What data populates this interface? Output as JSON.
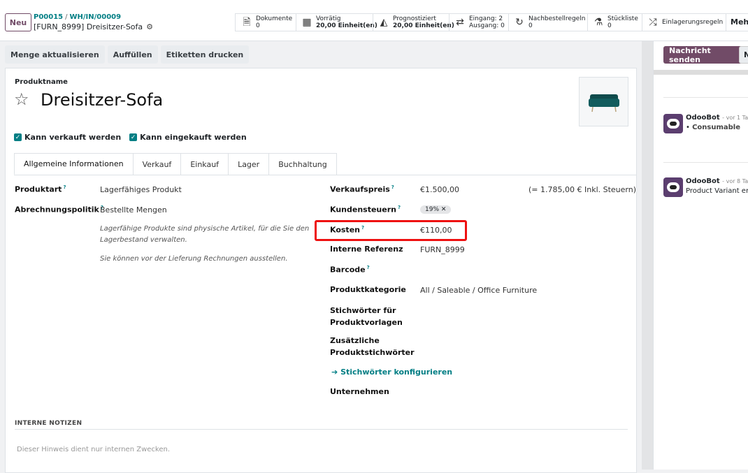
{
  "topbar": {
    "new_label": "Neu",
    "breadcrumb": [
      "P00015",
      "WH/IN/00009"
    ],
    "record_title": "[FURN_8999] Dreisitzer-Sofa",
    "smart_buttons": [
      {
        "icon": "document-icon",
        "label": "Dokumente",
        "value": "0"
      },
      {
        "icon": "cubes-icon",
        "label": "Vorrätig",
        "value": "20,00 Einheit(en)"
      },
      {
        "icon": "area-chart-icon",
        "label": "Prognostiziert",
        "value": "20,00 Einheit(en)"
      },
      {
        "icon": "exchange-icon",
        "label": "Eingang: 2",
        "value": "Ausgang: 0"
      },
      {
        "icon": "refresh-icon",
        "label": "Nachbestellregeln",
        "value": "0"
      },
      {
        "icon": "flask-icon",
        "label": "Stückliste",
        "value": "0"
      },
      {
        "icon": "random-icon",
        "label": "Einlagerungsregeln",
        "value": ""
      }
    ],
    "more_label": "Mehr"
  },
  "actions": [
    "Menge aktualisieren",
    "Auffüllen",
    "Etiketten drucken"
  ],
  "form": {
    "name_label": "Produktname",
    "name": "Dreisitzer-Sofa",
    "sale_ok": "Kann verkauft werden",
    "purchase_ok": "Kann eingekauft werden",
    "tabs": [
      "Allgemeine Informationen",
      "Verkauf",
      "Einkauf",
      "Lager",
      "Buchhaltung"
    ],
    "left": {
      "type_label": "Produktart",
      "type_value": "Lagerfähiges Produkt",
      "invoice_label": "Abrechnungspolitik",
      "invoice_value": "Bestellte Mengen",
      "note1": "Lagerfähige Produkte sind physische Artikel, für die Sie den Lagerbestand verwalten.",
      "note2": "Sie können vor der Lieferung Rechnungen ausstellen."
    },
    "right": {
      "price_label": "Verkaufspreis",
      "price_value": "€1.500,00",
      "price_tax": "(= 1.785,00 € Inkl. Steuern)",
      "taxes_label": "Kundensteuern",
      "taxes_value": "19%",
      "cost_label": "Kosten",
      "cost_value": "€110,00",
      "ref_label": "Interne Referenz",
      "ref_value": "FURN_8999",
      "barcode_label": "Barcode",
      "categ_label": "Produktkategorie",
      "categ_value": "All / Saleable / Office Furniture",
      "tags_label_1": "Stichwörter für",
      "tags_label_2": "Produktvorlagen",
      "extra_tags_label_1": "Zusätzliche",
      "extra_tags_label_2": "Produktstichwörter",
      "configure_link": "Stichwörter konfigurieren",
      "company_label": "Unternehmen"
    },
    "notes_heading": "INTERNE NOTIZEN",
    "notes_placeholder": "Dieser Hinweis dient nur internen Zwecken."
  },
  "chatter": {
    "send_label": "Nachricht senden",
    "second_button": "N",
    "messages": [
      {
        "author": "OdooBot",
        "time": "- vor 1 Ta",
        "body": "Consumable"
      },
      {
        "author": "OdooBot",
        "time": "- vor 8 Ta",
        "body": "Product Variant er"
      }
    ]
  }
}
